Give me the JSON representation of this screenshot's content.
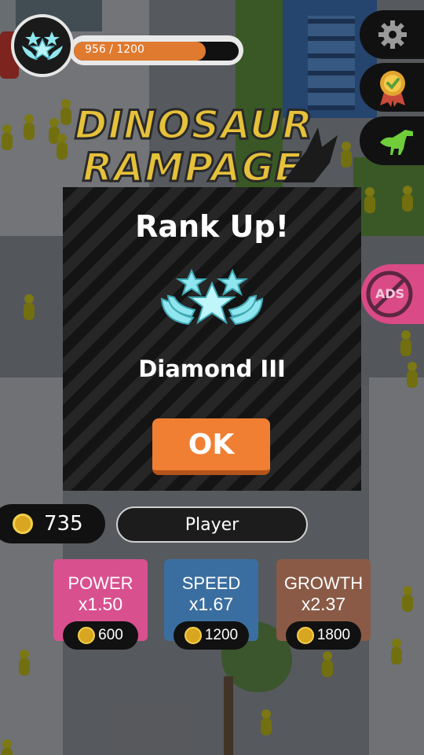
{
  "hud": {
    "xp_text": "956 / 1200",
    "xp_progress": 0.8
  },
  "logo": {
    "line1": "DINOSAUR",
    "line2": "RAMPAGE"
  },
  "dialog": {
    "title": "Rank Up!",
    "rank_name": "Diamond III",
    "ok_label": "OK"
  },
  "player": {
    "coins": "735",
    "name": "Player"
  },
  "side_buttons": [
    {
      "icon": "gear-icon"
    },
    {
      "icon": "award-ribbon-icon"
    },
    {
      "icon": "dinosaur-icon"
    },
    {
      "icon": "no-ads-icon",
      "text": "ADS"
    }
  ],
  "upgrades": [
    {
      "label": "POWER",
      "multiplier": "x1.50",
      "price": "600",
      "color": "#d9508f"
    },
    {
      "label": "SPEED",
      "multiplier": "x1.67",
      "price": "1200",
      "color": "#3b6ea0"
    },
    {
      "label": "GROWTH",
      "multiplier": "x2.37",
      "price": "1800",
      "color": "#8a5a46"
    }
  ],
  "colors": {
    "accent_orange": "#f07f33",
    "rank_cyan": "#8fe6ee"
  }
}
